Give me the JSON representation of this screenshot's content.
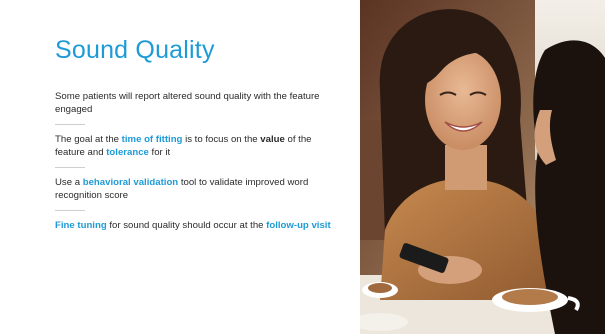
{
  "slide": {
    "title": "Sound Quality",
    "paragraphs": [
      {
        "segments": [
          {
            "text": "Some patients will report altered sound quality with the feature engaged",
            "style": "normal"
          }
        ]
      },
      {
        "segments": [
          {
            "text": "The goal at the ",
            "style": "normal"
          },
          {
            "text": "time of fitting",
            "style": "highlight"
          },
          {
            "text": " is to focus on the ",
            "style": "normal"
          },
          {
            "text": "value",
            "style": "bold"
          },
          {
            "text": " of the feature and ",
            "style": "normal"
          },
          {
            "text": "tolerance",
            "style": "highlight"
          },
          {
            "text": " for it",
            "style": "normal"
          }
        ]
      },
      {
        "segments": [
          {
            "text": "Use a ",
            "style": "normal"
          },
          {
            "text": "behavioral validation",
            "style": "highlight"
          },
          {
            "text": " tool to validate improved word recognition score",
            "style": "normal"
          }
        ]
      },
      {
        "segments": [
          {
            "text": "Fine tuning",
            "style": "highlight"
          },
          {
            "text": " for sound quality should occur at the ",
            "style": "normal"
          },
          {
            "text": "follow-up visit",
            "style": "highlight"
          }
        ]
      }
    ]
  },
  "colors": {
    "accent": "#1e9bd7",
    "text": "#2b2b2b",
    "background": "#ffffff"
  },
  "photo": {
    "subject": "two-women-cafe-photo"
  }
}
